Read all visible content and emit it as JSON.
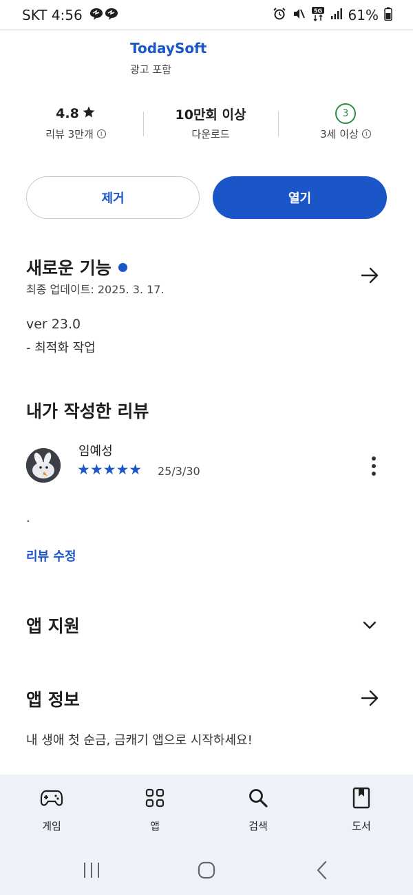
{
  "status_bar": {
    "carrier_time": "SKT 4:56",
    "network": "5G",
    "battery": "61%"
  },
  "app": {
    "developer": "TodaySoft",
    "ads_note": "광고 포함"
  },
  "stats": {
    "rating": "4.8",
    "rating_icon": "star-icon",
    "reviews": "리뷰 3만개",
    "downloads": "10만회 이상",
    "downloads_label": "다운로드",
    "age_badge": "3",
    "age_label": "3세 이상"
  },
  "buttons": {
    "remove": "제거",
    "open": "열기"
  },
  "whats_new": {
    "title": "새로운 기능",
    "updated": "최종 업데이트: 2025. 3. 17.",
    "version": "ver 23.0",
    "note": "- 최적화 작업"
  },
  "my_review": {
    "title": "내가 작성한 리뷰",
    "reviewer": "임예성",
    "stars": "★★★★★",
    "rating_value": 5,
    "date": "25/3/30",
    "text": ".",
    "edit_label": "리뷰 수정"
  },
  "app_support": {
    "title": "앱 지원"
  },
  "app_info": {
    "title": "앱 정보",
    "description": "내 생애 첫 순금, 금캐기 앱으로 시작하세요!"
  },
  "bottom_nav": {
    "items": [
      {
        "label": "게임",
        "icon": "gamepad-icon"
      },
      {
        "label": "앱",
        "icon": "apps-grid-icon"
      },
      {
        "label": "검색",
        "icon": "search-icon"
      },
      {
        "label": "도서",
        "icon": "book-icon"
      }
    ]
  },
  "colors": {
    "accent": "#1a56c8",
    "age_badge": "#2e8b43",
    "nav_background": "#eef1f8"
  }
}
